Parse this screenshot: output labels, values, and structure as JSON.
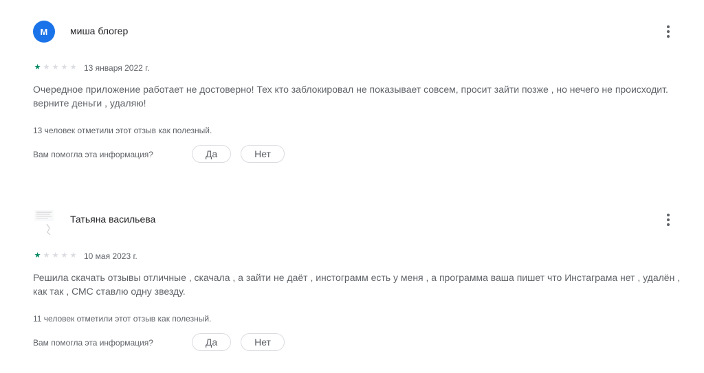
{
  "reviews": [
    {
      "avatar_letter": "М",
      "avatar_color": "#1a73e8",
      "author": "миша блогер",
      "rating": 1,
      "max_rating": 5,
      "date": "13 января 2022 г.",
      "text": "Очередное приложение работает не достоверно! Тех кто заблокировал не показывает совсем, просит зайти позже , но нечего не происходит. верните деньги , удаляю!",
      "helpful_count_text": "13 человек отметили этот отзыв как полезный.",
      "helpful_question": "Вам помогла эта информация?",
      "yes_label": "Да",
      "no_label": "Нет"
    },
    {
      "avatar_icon": "photo-avatar-icon",
      "author": "Татьяна васильева",
      "rating": 1,
      "max_rating": 5,
      "date": "10 мая 2023 г.",
      "text": "Решила скачать отзывы отличные , скачала , а зайти не даёт , инстограмм есть у меня , а программа ваша пишет что Инстаграма нет , удалён , как так , СМС ставлю одну звезду.",
      "helpful_count_text": "11 человек отметили этот отзыв как полезный.",
      "helpful_question": "Вам помогла эта информация?",
      "yes_label": "Да",
      "no_label": "Нет"
    }
  ],
  "colors": {
    "star_filled": "#01875f",
    "star_empty": "#dadce0",
    "secondary_text": "#5f6368"
  },
  "icons": {
    "star": "★",
    "more": "more-vert-icon"
  }
}
